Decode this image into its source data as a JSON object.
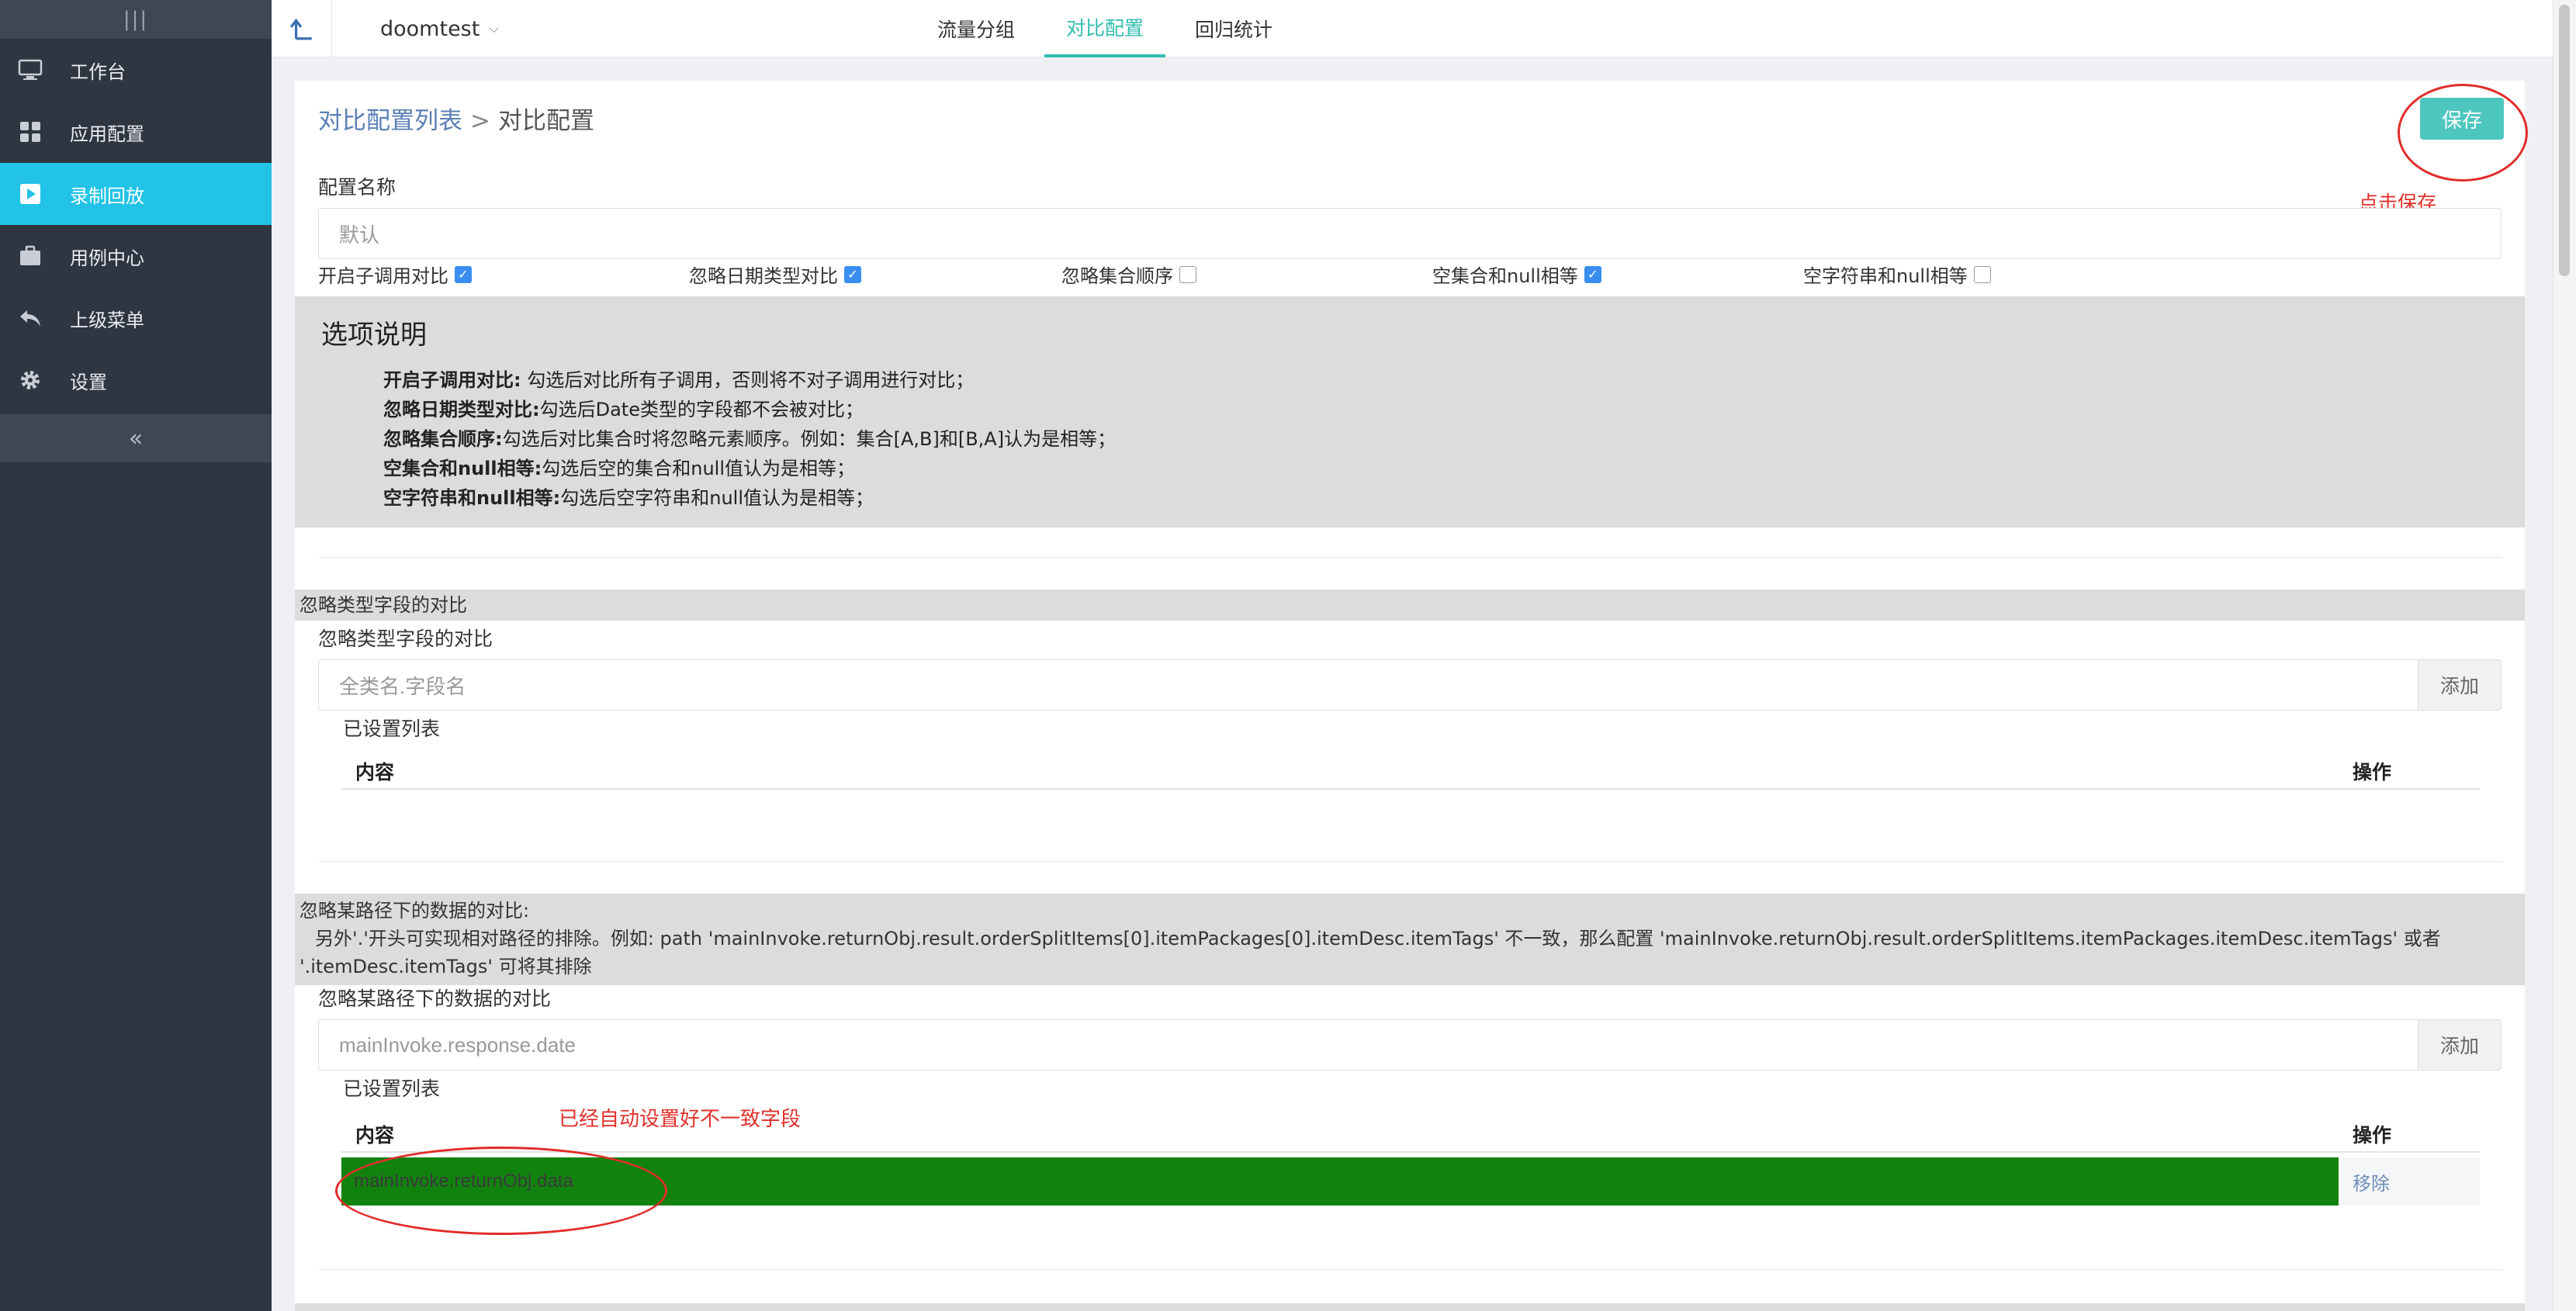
{
  "sidebar": {
    "top_icon": "|||",
    "collapse_icon": "«",
    "items": [
      {
        "label": "工作台",
        "icon": "monitor-icon",
        "active": false
      },
      {
        "label": "应用配置",
        "icon": "grid-icon",
        "active": false
      },
      {
        "label": "录制回放",
        "icon": "play-icon",
        "active": true
      },
      {
        "label": "用例中心",
        "icon": "briefcase-icon",
        "active": false
      },
      {
        "label": "上级菜单",
        "icon": "undo-icon",
        "active": false
      },
      {
        "label": "设置",
        "icon": "gear-icon",
        "active": false
      }
    ]
  },
  "topbar": {
    "app_name": "doomtest",
    "tabs": [
      {
        "label": "流量分组",
        "active": false
      },
      {
        "label": "对比配置",
        "active": true
      },
      {
        "label": "回归统计",
        "active": false
      }
    ]
  },
  "breadcrumb": {
    "parent": "对比配置列表",
    "separator": ">",
    "current": "对比配置"
  },
  "save": {
    "label": "保存",
    "annotation": "点击保存"
  },
  "config_name": {
    "label": "配置名称",
    "placeholder": "默认"
  },
  "checkboxes": [
    {
      "label": "开启子调用对比",
      "checked": true
    },
    {
      "label": "忽略日期类型对比",
      "checked": true
    },
    {
      "label": "忽略集合顺序",
      "checked": false
    },
    {
      "label": "空集合和null相等",
      "checked": true
    },
    {
      "label": "空字符串和null相等",
      "checked": false
    }
  ],
  "options_help": {
    "title": "选项说明",
    "lines": [
      {
        "term": "开启子调用对比:",
        "desc": " 勾选后对比所有子调用，否则将不对子调用进行对比；"
      },
      {
        "term": "忽略日期类型对比:",
        "desc": "勾选后Date类型的字段都不会被对比；"
      },
      {
        "term": "忽略集合顺序:",
        "desc": "勾选后对比集合时将忽略元素顺序。例如：集合[A,B]和[B,A]认为是相等；"
      },
      {
        "term": "空集合和null相等:",
        "desc": "勾选后空的集合和null值认为是相等；"
      },
      {
        "term": "空字符串和null相等:",
        "desc": "勾选后空字符串和null值认为是相等；"
      }
    ]
  },
  "ignore_type": {
    "section_title": "忽略类型字段的对比",
    "label": "忽略类型字段的对比",
    "placeholder": "全类名.字段名",
    "add_label": "添加",
    "list_title": "已设置列表",
    "col_content": "内容",
    "col_action": "操作"
  },
  "ignore_path": {
    "section_title": "忽略某路径下的数据的对比:",
    "section_desc_1": "另外'.'开头可实现相对路径的排除。例如: path 'mainInvoke.returnObj.result.orderSplitItems[0].itemPackages[0].itemDesc.itemTags' 不一致，那么配置 'mainInvoke.returnObj.result.orderSplitItems.itemPackages.itemDesc.itemTags' 或者",
    "section_desc_2": "'.itemDesc.itemTags' 可将其排除",
    "label": "忽略某路径下的数据的对比",
    "placeholder": "mainInvoke.response.date",
    "add_label": "添加",
    "list_title": "已设置列表",
    "col_content": "内容",
    "col_action": "操作",
    "annotation": "已经自动设置好不一致字段",
    "rows": [
      {
        "content": "mainInvoke.returnObj.data",
        "action": "移除"
      }
    ]
  },
  "colors": {
    "accent": "#2fbdb0",
    "sidebar_active": "#22c3e6",
    "row_highlight": "#12820f",
    "annotation": "#e0302b"
  }
}
